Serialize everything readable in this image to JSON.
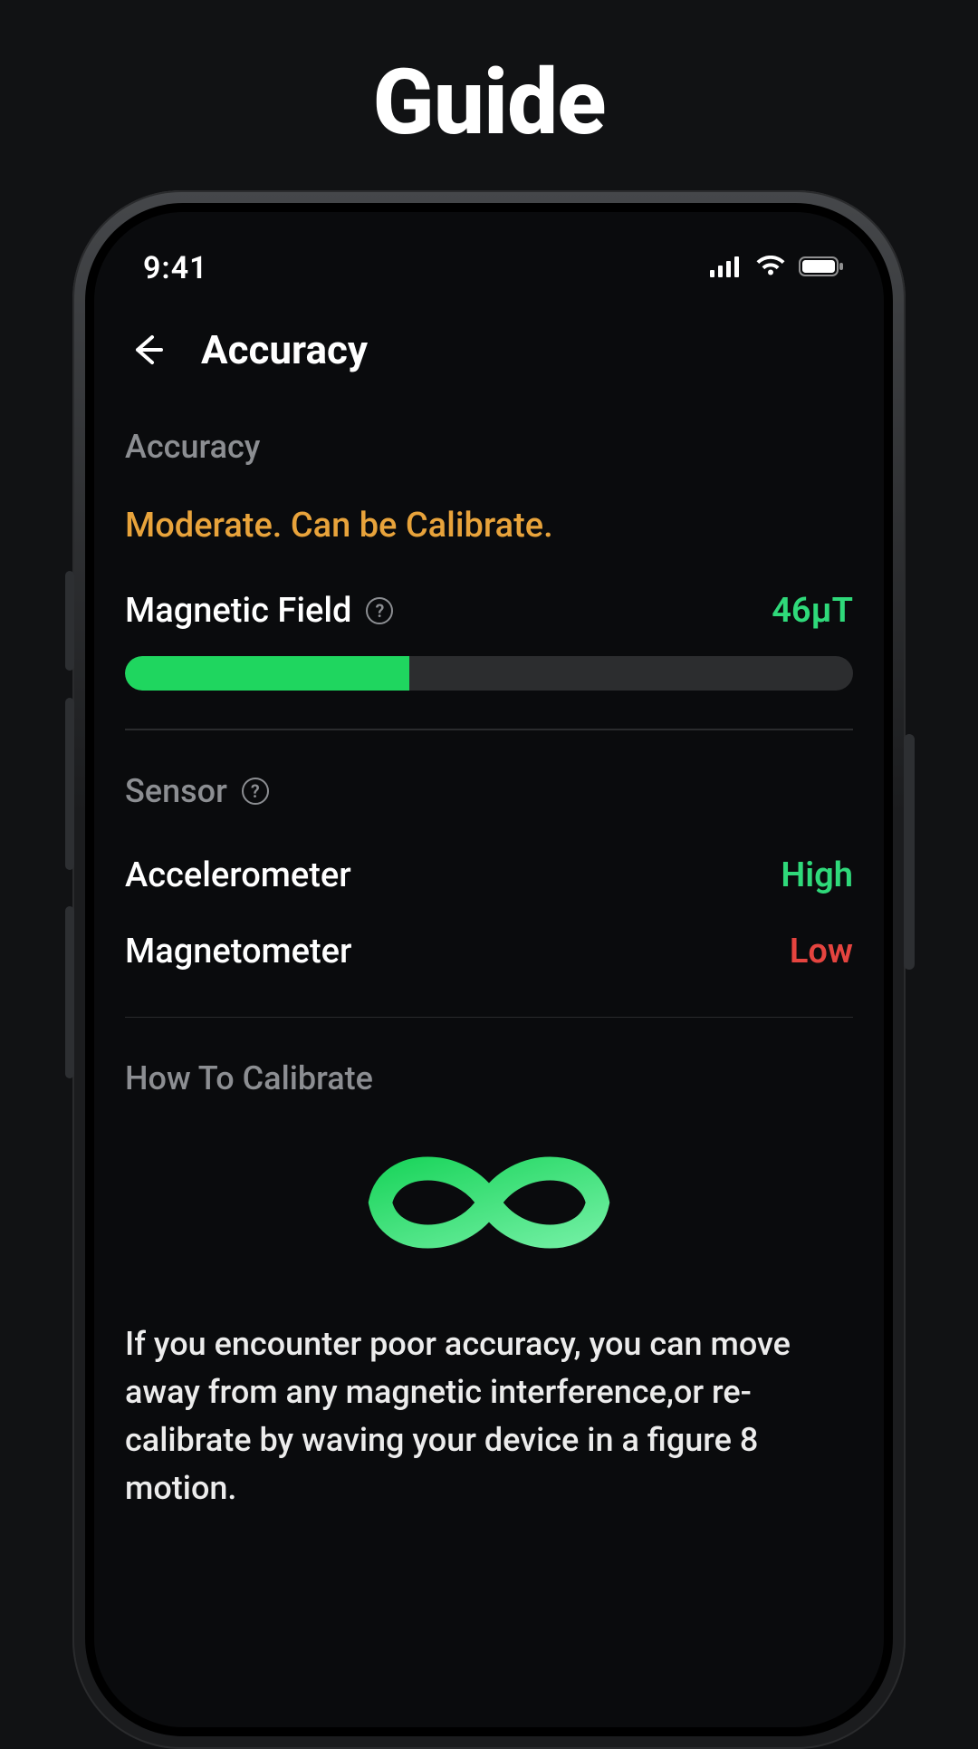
{
  "page": {
    "title": "Guide"
  },
  "statusbar": {
    "time": "9:41"
  },
  "header": {
    "title": "Accuracy"
  },
  "accuracy": {
    "section_label": "Accuracy",
    "status_text": "Moderate. Can be Calibrate.",
    "magnetic_field_label": "Magnetic Field",
    "magnetic_field_value": "46μT",
    "progress_percent": 39
  },
  "sensor": {
    "section_label": "Sensor",
    "items": [
      {
        "name": "Accelerometer",
        "value": "High",
        "color": "#2fd97a"
      },
      {
        "name": "Magnetometer",
        "value": "Low",
        "color": "#e5443f"
      }
    ]
  },
  "howto": {
    "section_label": "How To Calibrate",
    "text": "If you encounter poor accuracy,  you can move away from any magnetic interference,or re-calibrate by waving your device in a figure 8 motion."
  },
  "colors": {
    "accent_green": "#1fd65f",
    "accent_green_light": "#5fe896",
    "warn_orange": "#e8a33b",
    "value_green": "#2fd97a",
    "value_red": "#e5443f"
  }
}
